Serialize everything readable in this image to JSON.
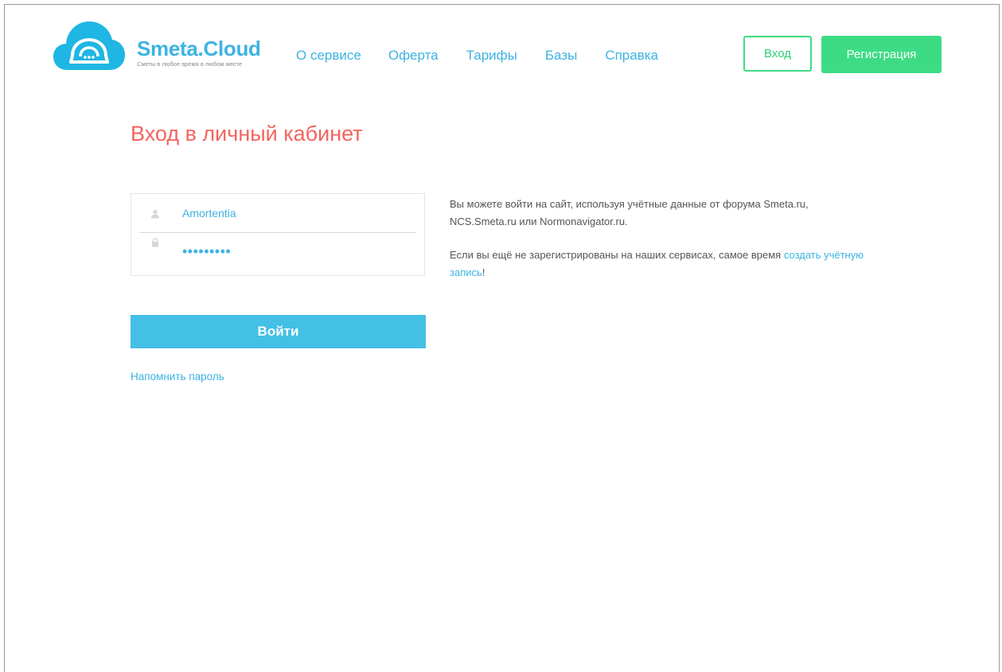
{
  "brand": {
    "name": "Smeta.Cloud",
    "tagline": "Сметы в любое время в любом месте"
  },
  "nav": {
    "items": [
      {
        "label": "О сервисе"
      },
      {
        "label": "Оферта"
      },
      {
        "label": "Тарифы"
      },
      {
        "label": "Базы"
      },
      {
        "label": "Справка"
      }
    ]
  },
  "header": {
    "login_label": "Вход",
    "register_label": "Регистрация"
  },
  "main": {
    "title": "Вход в личный кабинет",
    "username_value": "Amortentia",
    "password_value": "•••••••••",
    "submit_label": "Войти",
    "forgot_label": "Напомнить пароль",
    "info_para1": "Вы можете войти на сайт, используя учётные данные от форума Smeta.ru, NCS.Smeta.ru или Normonavigator.ru.",
    "info_para2_text": "Если вы ещё не зарегистрированы на наших сервисах, самое время ",
    "info_para2_link": "создать учётную запись",
    "info_para2_end": "!"
  },
  "colors": {
    "accent": "#3db3e2",
    "title": "#f4645f",
    "green": "#3ddc84",
    "submit": "#44bfe6"
  },
  "icons": {
    "logo": "cloud-dome-icon",
    "user": "user-icon",
    "lock": "lock-icon"
  }
}
